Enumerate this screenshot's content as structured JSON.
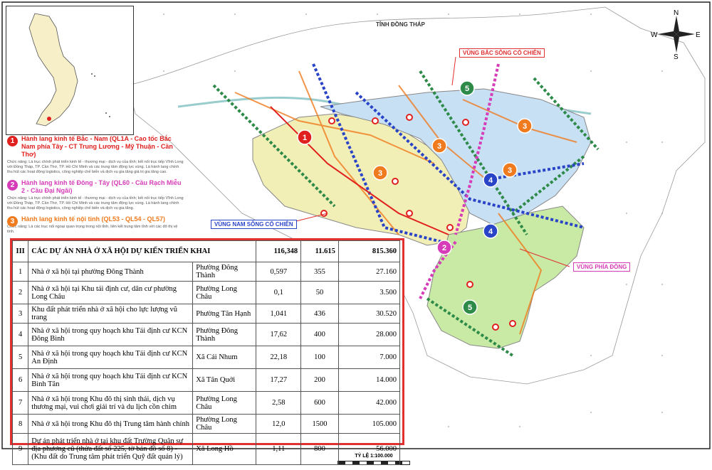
{
  "map": {
    "province_label": "TỈNH ĐỒNG THÁP",
    "region_labels": {
      "north": "VÙNG BẮC SÔNG CỔ CHIÊN",
      "south": "VÙNG NAM SÔNG CỔ CHIÊN",
      "east": "VÙNG PHÍA ĐÔNG"
    },
    "scale_label": "TỶ LỆ 1:100.000",
    "compass": {
      "n": "N",
      "s": "S",
      "e": "E",
      "w": "W"
    },
    "colors": {
      "water": "#ffffff",
      "north_zone": "#c8e0f4",
      "south_zone": "#f2efb6",
      "east_zone": "#c9eaa4",
      "corridor1": "#e0201e",
      "corridor2": "#d63cb8",
      "corridor3": "#f07a1e",
      "corridor4": "#2a44c8",
      "corridor5": "#2e8a48",
      "highlight": "#e03030"
    },
    "markers": [
      {
        "num": "1",
        "color": "#e0201e"
      },
      {
        "num": "2",
        "color": "#d63cb8"
      },
      {
        "num": "3",
        "color": "#f07a1e"
      },
      {
        "num": "3",
        "color": "#f07a1e"
      },
      {
        "num": "3",
        "color": "#f07a1e"
      },
      {
        "num": "3",
        "color": "#f07a1e"
      },
      {
        "num": "4",
        "color": "#2a44c8"
      },
      {
        "num": "4",
        "color": "#2a44c8"
      },
      {
        "num": "5",
        "color": "#2e8a48"
      },
      {
        "num": "5",
        "color": "#2e8a48"
      }
    ]
  },
  "legend": [
    {
      "num": "1",
      "color": "#e0201e",
      "title": "Hành lang kinh tế Bắc - Nam (QL1A - Cao tốc Bắc Nam phía Tây - CT Trung Lương - Mỹ Thuận - Cần Thơ)",
      "desc": "Chức năng: Là trục chính phát triển kinh tế - thương mại - dịch vụ của tỉnh; kết nối trục tiếp Vĩnh Long với Đồng Tháp, TP. Cần Thơ, TP. Hồ Chí Minh và các trung tâm động lực vùng. Là hành lang chính thu hút các hoạt động logistics, công nghiệp chế biến và dịch vụ gia tăng giá trị gia tăng cao."
    },
    {
      "num": "2",
      "color": "#d63cb8",
      "title": "Hành lang kinh tế Đông - Tây (QL60 - Cầu Rạch Miễu 2 - Cầu Đại Ngãi)",
      "desc": "Chức năng: Là trục chính phát triển kinh tế - thương mại - dịch vụ của tỉnh; kết nối trục tiếp Vĩnh Long với Đồng Tháp, TP. Cần Thơ, TP. Hồ Chí Minh và các trung tâm động lực vùng. Là hành lang chính thu hút các hoạt động logistics, công nghiệp chế biến và dịch vụ gia tăng."
    },
    {
      "num": "3",
      "color": "#f07a1e",
      "title": "Hành lang kinh tế nội tỉnh (QL53 - QL54 - QL57)",
      "desc": "Chức năng: Là các trục nối ngoại quan trọng trong nội tỉnh, liên kết trung tâm tỉnh với các đô thị vệ tinh."
    }
  ],
  "table": {
    "header": {
      "num": "III",
      "title": "CÁC DỰ ÁN NHÀ Ở XÃ HỘI DỰ KIẾN TRIỂN KHAI",
      "area": "116,348",
      "units": "11.615",
      "people": "815.360"
    },
    "rows": [
      {
        "num": "1",
        "name": "Nhà ở xã hội tại phường Đông Thành",
        "ward": "Phường Đông Thành",
        "area": "0,597",
        "units": "355",
        "people": "27.160"
      },
      {
        "num": "2",
        "name": "Nhà ở xã hội tại Khu tái định cư, dân cư phường Long Châu",
        "ward": "Phường Long Châu",
        "area": "0,1",
        "units": "50",
        "people": "3.500"
      },
      {
        "num": "3",
        "name": "Khu đất phát triển nhà ở xã hội cho lực lượng vũ trang",
        "ward": "Phường Tân Hạnh",
        "area": "1,041",
        "units": "436",
        "people": "30.520"
      },
      {
        "num": "4",
        "name": "Nhà ở xã hội trong quy hoạch khu Tái định cư KCN Đông Bình",
        "ward": "Phường Đông Thành",
        "area": "17,62",
        "units": "400",
        "people": "28.000"
      },
      {
        "num": "5",
        "name": "Nhà ở xã hội trong quy hoạch khu Tái định cư KCN An Định",
        "ward": "Xã Cái Nhum",
        "area": "22,18",
        "units": "100",
        "people": "7.000"
      },
      {
        "num": "6",
        "name": "Nhà ở xã hội trong quy hoạch khu Tái định cư KCN Bình Tân",
        "ward": "Xã Tân Quới",
        "area": "17,27",
        "units": "200",
        "people": "14.000"
      },
      {
        "num": "7",
        "name": "Nhà ở xã hội trong Khu đô thị sinh thái, dịch vụ thương mại, vui chơi giải trí và du lịch cồn chim",
        "ward": "Phường Long Châu",
        "area": "2,58",
        "units": "600",
        "people": "42.000"
      },
      {
        "num": "8",
        "name": "Nhà ở xã hội trong Khu đô thị Trung tâm hành chính",
        "ward": "Phường Long Châu",
        "area": "12,0",
        "units": "1500",
        "people": "105.000"
      },
      {
        "num": "9",
        "name": "Dự án phát triển nhà ở tại khu đất Trường Quân sự địa phương cũ (thửa đất số 225, tờ bản đồ số 8) - (Khu đất do Trung tâm phát triển Quỹ đất quản lý)",
        "ward": "Xã Long Hồ",
        "area": "1,11",
        "units": "800",
        "people": "56.000"
      }
    ]
  }
}
